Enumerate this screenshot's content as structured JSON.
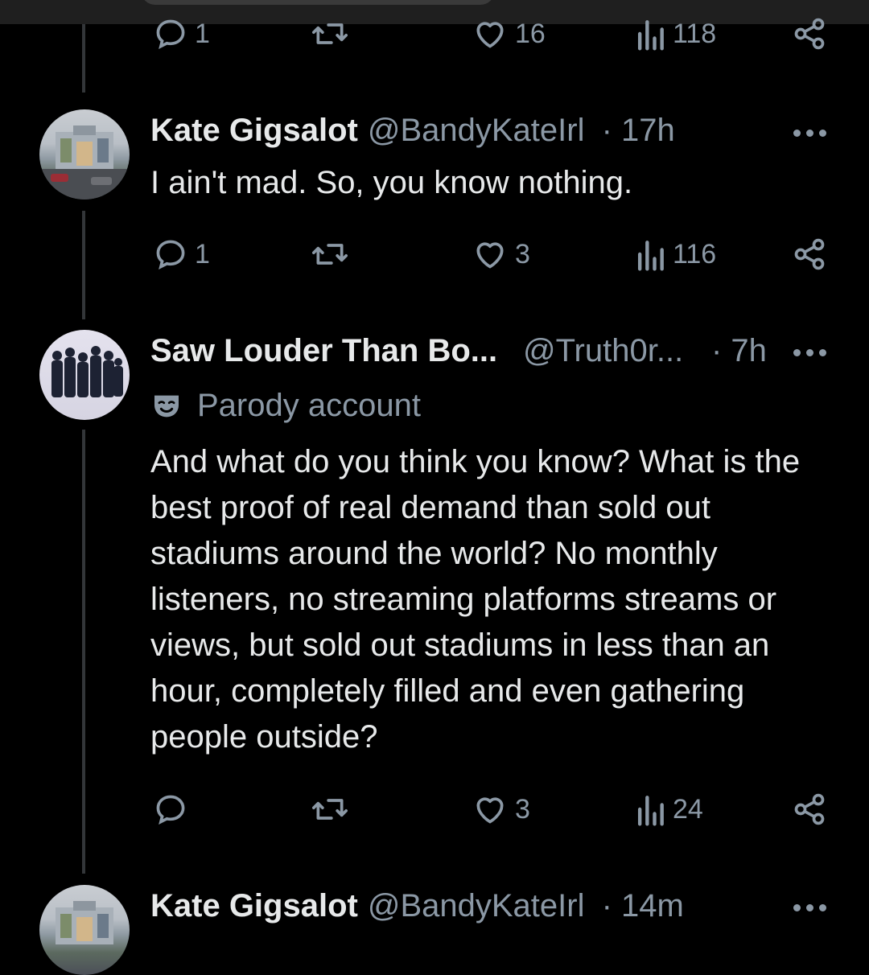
{
  "tweets": [
    {
      "stats": {
        "replies": "1",
        "retweets": "",
        "likes": "16",
        "views": "118"
      }
    },
    {
      "name": "Kate Gigsalot",
      "handle": "@BandyKateIrl",
      "time": "· 17h",
      "text": "I ain't mad. So, you know nothing.",
      "stats": {
        "replies": "1",
        "retweets": "",
        "likes": "3",
        "views": "116"
      }
    },
    {
      "name": "Saw Louder Than Bo...",
      "handle": "@Truth0r...",
      "time": "· 7h",
      "label": "Parody account",
      "text": "And what do you think you know? What is the best proof of real demand than sold out stadiums around the world? No monthly listeners, no streaming platforms streams or views, but sold out stadiums in less than an hour, completely filled and even gathering people outside?",
      "stats": {
        "replies": "",
        "retweets": "",
        "likes": "3",
        "views": "24"
      }
    },
    {
      "name": "Kate Gigsalot",
      "handle": "@BandyKateIrl",
      "time": "· 14m"
    }
  ],
  "icons": {
    "reply": "reply-icon",
    "retweet": "retweet-icon",
    "like": "heart-icon",
    "views": "views-icon",
    "share": "share-icon",
    "more": "more-icon",
    "parody": "parody-mask-icon"
  },
  "colors": {
    "background": "#000000",
    "text": "#e7e9ea",
    "muted": "#8b98a5",
    "thread_line": "#333639"
  }
}
